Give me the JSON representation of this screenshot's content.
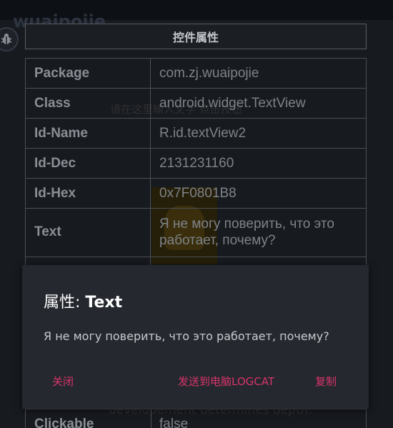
{
  "app": {
    "title": "wuaipojie"
  },
  "background": {
    "line1": "请在这里输入文字 点击按钮",
    "line2": "developement determines depth."
  },
  "panel": {
    "header": "控件属性",
    "rows": [
      {
        "key": "Package",
        "value": "com.zj.wuaipojie"
      },
      {
        "key": "Class",
        "value": "android.widget.TextView"
      },
      {
        "key": "Id-Name",
        "value": "R.id.textView2"
      },
      {
        "key": "Id-Dec",
        "value": "2131231160"
      },
      {
        "key": "Id-Hex",
        "value": "0x7F0801B8"
      },
      {
        "key": "Text",
        "value": "Я не могу поверить, что это работает, почему?"
      }
    ],
    "last_row": {
      "key": "Clickable",
      "value": "false"
    }
  },
  "dialog": {
    "title_prefix": "属性: ",
    "title_field": "Text",
    "message": "Я не могу поверить, что это работает, почему?",
    "buttons": {
      "close": "关闭",
      "send_logcat": "发送到电脑LOGCAT",
      "copy": "复制"
    }
  },
  "colors": {
    "accent": "#d8346a",
    "dialog_bg": "#25282e",
    "page_bg": "#171a1f"
  }
}
